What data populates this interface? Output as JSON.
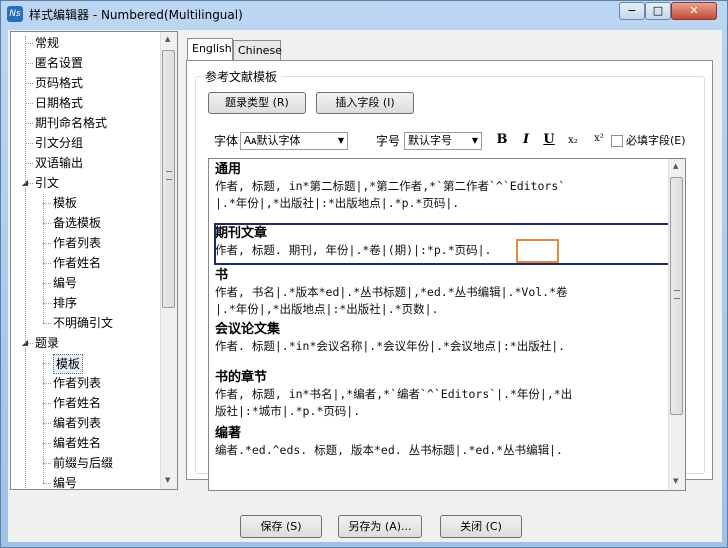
{
  "window": {
    "title": "样式编辑器 - Numbered(Multilingual)",
    "app_icon": "Ns"
  },
  "tree": {
    "items": [
      {
        "label": "常规",
        "level": 0
      },
      {
        "label": "匿名设置",
        "level": 0
      },
      {
        "label": "页码格式",
        "level": 0
      },
      {
        "label": "日期格式",
        "level": 0
      },
      {
        "label": "期刊命名格式",
        "level": 0
      },
      {
        "label": "引文分组",
        "level": 0
      },
      {
        "label": "双语输出",
        "level": 0
      },
      {
        "label": "引文",
        "level": 0,
        "expanded": true
      },
      {
        "label": "模板",
        "level": 1
      },
      {
        "label": "备选模板",
        "level": 1
      },
      {
        "label": "作者列表",
        "level": 1
      },
      {
        "label": "作者姓名",
        "level": 1
      },
      {
        "label": "编号",
        "level": 1
      },
      {
        "label": "排序",
        "level": 1
      },
      {
        "label": "不明确引文",
        "level": 1
      },
      {
        "label": "题录",
        "level": 0,
        "expanded": true
      },
      {
        "label": "模板",
        "level": 1,
        "selected": true
      },
      {
        "label": "作者列表",
        "level": 1
      },
      {
        "label": "作者姓名",
        "level": 1
      },
      {
        "label": "编者列表",
        "level": 1
      },
      {
        "label": "编者姓名",
        "level": 1
      },
      {
        "label": "前缀与后缀",
        "level": 1
      },
      {
        "label": "编号",
        "level": 1
      }
    ]
  },
  "tabs": [
    {
      "label": "English",
      "active": true
    },
    {
      "label": "Chinese",
      "active": false
    }
  ],
  "group_title": "参考文献模板",
  "toolbar": {
    "ref_type_button": "题录类型 (R)",
    "insert_field_button": "插入字段 (I)",
    "font_label": "字体",
    "font_value": "默认字体",
    "size_label": "字号",
    "size_value": "默认字号",
    "bold": "B",
    "italic": "I",
    "underline": "U",
    "subscript": "x₂",
    "superscript": "x²",
    "required_label": "必填字段(E)"
  },
  "entries": [
    {
      "title": "通用",
      "lines": [
        "作者, 标题, in*第二标题|,*第二作者,*`第二作者`^`Editors`",
        "|.*年份|,*出版社|:*出版地点|.*p.*页码|."
      ]
    },
    {
      "title": "期刊文章",
      "lines": [
        "作者, 标题. 期刊, 年份|.*卷|(期)|:*p.*页码|."
      ]
    },
    {
      "title": "书",
      "lines": [
        "作者, 书名|.*版本*ed|.*丛书标题|,*ed.*丛书编辑|.*Vol.*卷",
        "|.*年份|,*出版地点|:*出版社|.*页数|."
      ]
    },
    {
      "title": "会议论文集",
      "lines": [
        "作者. 标题|.*in*会议名称|.*会议年份|.*会议地点|:*出版社|."
      ]
    },
    {
      "title": "书的章节",
      "lines": [
        "作者, 标题, in*书名|,*编者,*`编者`^`Editors`|.*年份|,*出",
        "版社|:*城市|.*p.*页码|."
      ]
    },
    {
      "title": "编著",
      "lines": [
        "编者.*ed.^eds. 标题, 版本*ed. 丛书标题|.*ed.*丛书编辑|."
      ]
    }
  ],
  "buttons": {
    "save": "保存 (S)",
    "save_as": "另存为 (A)...",
    "close": "关闭 (C)"
  }
}
